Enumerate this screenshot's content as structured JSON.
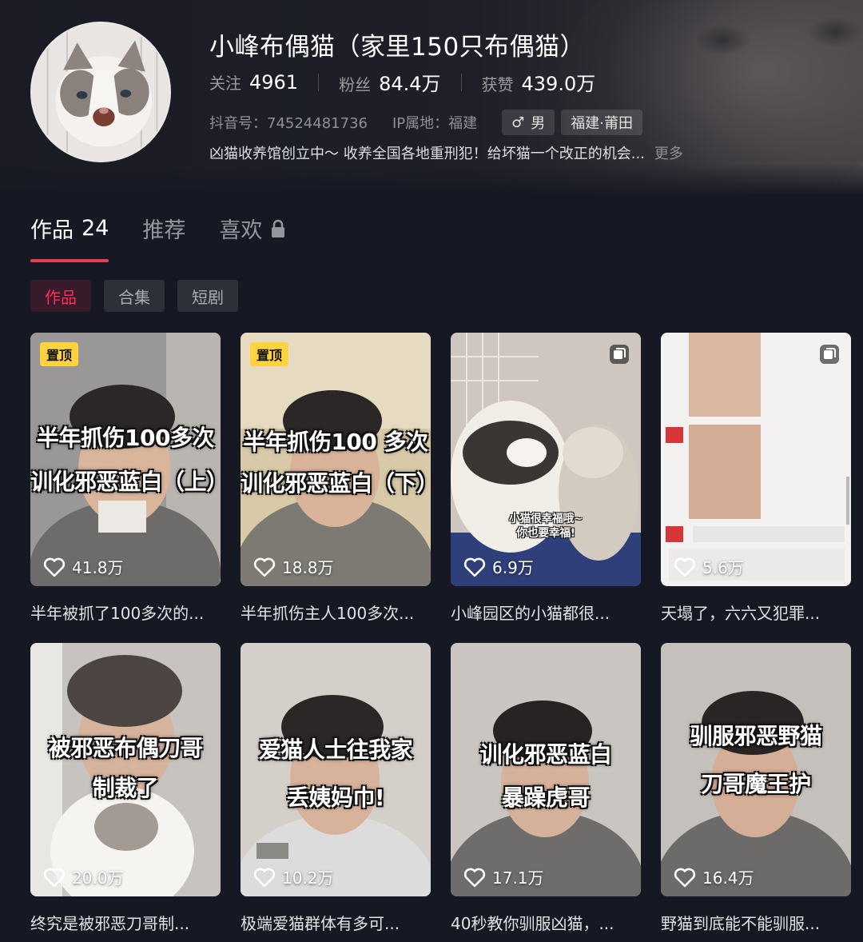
{
  "profile": {
    "name": "小峰布偶猫（家里150只布偶猫）",
    "stats": [
      {
        "label": "关注",
        "value": "4961"
      },
      {
        "label": "粉丝",
        "value": "84.4万"
      },
      {
        "label": "获赞",
        "value": "439.0万"
      }
    ],
    "douyin_id": "抖音号：74524481736",
    "ip_location": "IP属地：福建",
    "gender": "男",
    "region": "福建·莆田",
    "bio": "凶猫收养馆创立中～ 收养全国各地重刑犯！给坏猫一个改正的机会...",
    "bio_more": "更多"
  },
  "tabs": {
    "works_label": "作品",
    "works_count": "24",
    "recommend_label": "推荐",
    "likes_label": "喜欢"
  },
  "subtabs": [
    "作品",
    "合集",
    "短剧"
  ],
  "videos": [
    {
      "pin": "置顶",
      "caption1": "半年抓伤100多次",
      "caption2": "训化邪恶蓝白（上）",
      "likes": "41.8万",
      "title": "半年被抓了100多次的..."
    },
    {
      "pin": "置顶",
      "caption1": "半年抓伤100 多次",
      "caption2": "训化邪恶蓝白（下）",
      "likes": "18.8万",
      "title": "半年抓伤主人100多次..."
    },
    {
      "caption1": "小猫很幸福哦~",
      "caption2": "你也要幸福!",
      "likes": "6.9万",
      "title": "小峰园区的小猫都很..."
    },
    {
      "likes": "5.6万",
      "title": "天塌了，六六又犯罪..."
    },
    {
      "caption1": "被邪恶布偶刀哥",
      "caption2": "制裁了",
      "likes": "20.0万",
      "title": "终究是被邪恶刀哥制..."
    },
    {
      "caption1": "爱猫人士往我家",
      "caption2": "丢姨妈巾!",
      "likes": "10.2万",
      "title": "极端爱猫群体有多可..."
    },
    {
      "caption1": "训化邪恶蓝白",
      "caption2": "暴躁虎哥",
      "likes": "17.1万",
      "title": "40秒教你驯服凶猫，..."
    },
    {
      "caption1": "驯服邪恶野猫",
      "caption2": "刀哥魔王护",
      "likes": "16.4万",
      "title": "野猫到底能不能驯服..."
    }
  ],
  "colors": {
    "background": "#161823",
    "accent": "#fe2c55",
    "tab_underline": "#e0434e",
    "pin_badge": "#ffd33d"
  },
  "icons": [
    "heart-icon",
    "lock-icon",
    "male-icon",
    "multi-image-icon"
  ]
}
